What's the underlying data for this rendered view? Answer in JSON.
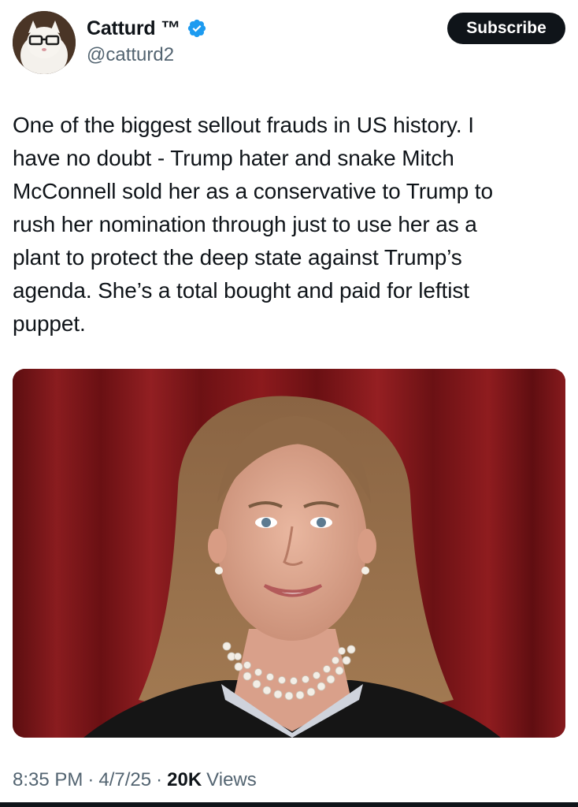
{
  "post": {
    "author": {
      "display_name": "Catturd ™",
      "handle": "@catturd2",
      "verified": true
    },
    "subscribe_label": "Subscribe",
    "text": "One of the biggest sellout frauds in US history. I\nhave no doubt - Trump hater and snake Mitch\nMcConnell sold her as a conservative to Trump to\nrush her nomination through just to use her as a\nplant to protect the deep state against Trump’s\nagenda. She’s a total bought and paid for leftist\npuppet.",
    "time": "8:35 PM",
    "date": "4/7/25",
    "separator": "·",
    "views_count": "20K",
    "views_label": "Views"
  },
  "colors": {
    "text_primary": "#0f1419",
    "text_secondary": "#536471",
    "verified_blue": "#1d9bf0",
    "button_bg": "#0f1419",
    "curtain_red": "#7a1518"
  },
  "icons": {
    "verified": "verified-badge-icon"
  }
}
